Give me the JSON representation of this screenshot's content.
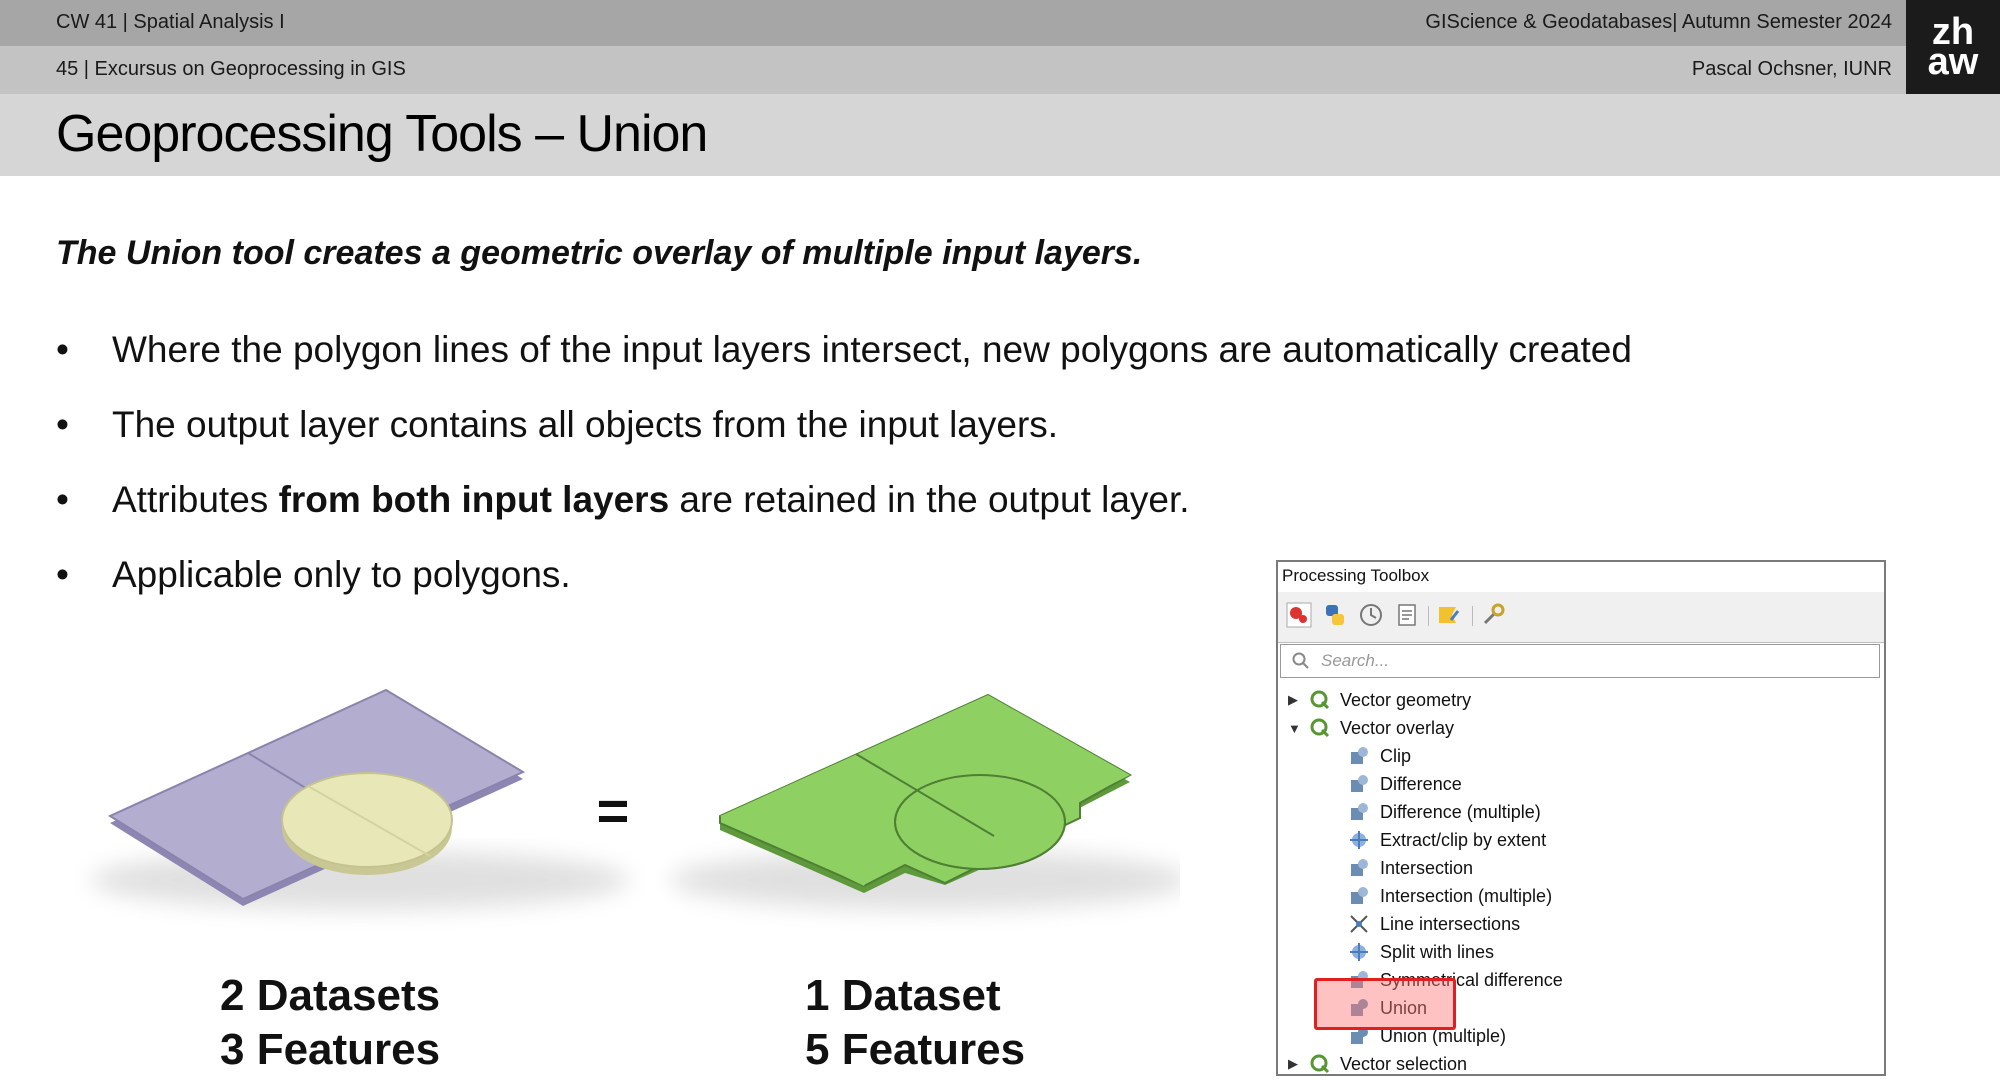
{
  "header": {
    "course": "CW 41 | Spatial Analysis I",
    "section": "45 | Excursus on Geoprocessing in GIS",
    "program": "GIScience & Geodatabases| Autumn Semester 2024",
    "author": "Pascal Ochsner, IUNR",
    "logo_line1": "zh",
    "logo_line2": "aw"
  },
  "slide": {
    "title": "Geoprocessing Tools – Union",
    "lead": "The Union tool creates a geometric overlay of multiple input layers.",
    "bullets": {
      "b1": "Where the polygon lines of the input layers intersect, new polygons are automatically created",
      "b2": "The output layer contains all objects from the input layers.",
      "b3_pre": "Attributes ",
      "b3_bold": "from both input layers",
      "b3_post": " are retained in the output layer.",
      "b4": "Applicable only to polygons."
    },
    "bullet_char": "•"
  },
  "illustration": {
    "equals": "=",
    "left_caption_1": "2 Datasets",
    "left_caption_2": "3 Features",
    "right_caption_1": "1 Dataset",
    "right_caption_2": "5 Features",
    "colors": {
      "purple": "#b3aed0",
      "yellow": "#e8e7b8",
      "green": "#8fd063"
    }
  },
  "toolbox": {
    "title": "Processing Toolbox",
    "search_placeholder": "Search...",
    "groups": {
      "vector_geometry": "Vector geometry",
      "vector_overlay": "Vector overlay",
      "vector_selection": "Vector selection"
    },
    "items": [
      "Clip",
      "Difference",
      "Difference (multiple)",
      "Extract/clip by extent",
      "Intersection",
      "Intersection (multiple)",
      "Line intersections",
      "Split with lines",
      "Symmetrical difference",
      "Union",
      "Union (multiple)"
    ],
    "highlighted_item": "Union",
    "icons": [
      "processing-models-icon",
      "python-icon",
      "history-icon",
      "results-icon",
      "edit-features-icon",
      "options-icon"
    ]
  }
}
